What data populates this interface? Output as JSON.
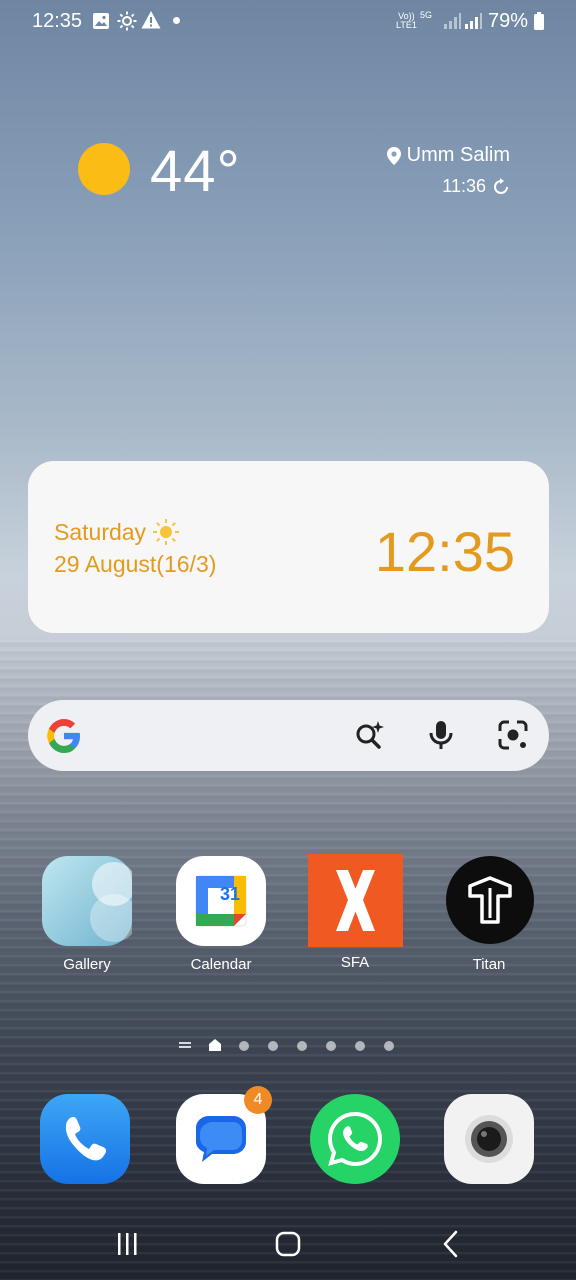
{
  "status_bar": {
    "time": "12:35",
    "volte_top": "Vo))",
    "volte_bottom": "LTE1",
    "network": "5G",
    "battery_percent": "79%"
  },
  "weather": {
    "temperature": "44°",
    "location": "Umm Salim",
    "updated_time": "11:36",
    "sun_color": "#fbbd15"
  },
  "clock_widget": {
    "day": "Saturday",
    "date": "29 August(16/3)",
    "time": "12:35",
    "accent_color": "#e49a1e"
  },
  "search_bar": {
    "icons": [
      "google-logo",
      "ai-search-icon",
      "mic-icon",
      "lens-camera-icon"
    ]
  },
  "apps": [
    {
      "label": "Gallery"
    },
    {
      "label": "Calendar",
      "icon_text": "31"
    },
    {
      "label": "SFA"
    },
    {
      "label": "Titan"
    }
  ],
  "page_indicator": {
    "pages": 6,
    "current": "home"
  },
  "dock": {
    "messages_badge": "4",
    "items": [
      "phone-icon",
      "messages-icon",
      "whatsapp-icon",
      "camera-icon"
    ]
  },
  "nav": {
    "buttons": [
      "recents",
      "home",
      "back"
    ]
  }
}
